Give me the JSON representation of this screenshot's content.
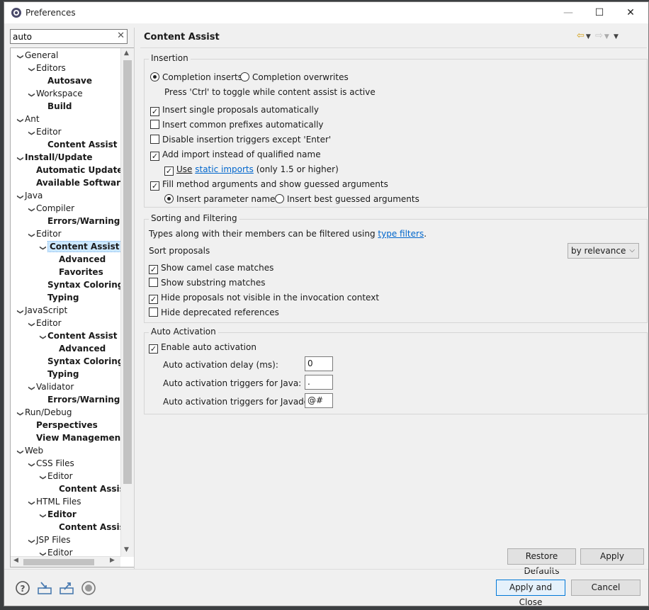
{
  "window": {
    "title": "Preferences",
    "min_label": "—",
    "max_label": "☐",
    "close_label": "✕"
  },
  "filter": {
    "value": "auto",
    "clear_label": "✕"
  },
  "tree": [
    {
      "label": "General",
      "level": 0,
      "twisty": "v",
      "bold": false
    },
    {
      "label": "Editors",
      "level": 1,
      "twisty": "v",
      "bold": false
    },
    {
      "label": "Autosave",
      "level": 2,
      "twisty": "",
      "bold": true
    },
    {
      "label": "Workspace",
      "level": 1,
      "twisty": "v",
      "bold": false
    },
    {
      "label": "Build",
      "level": 2,
      "twisty": "",
      "bold": true
    },
    {
      "label": "Ant",
      "level": 0,
      "twisty": "v",
      "bold": false
    },
    {
      "label": "Editor",
      "level": 1,
      "twisty": "v",
      "bold": false
    },
    {
      "label": "Content Assist",
      "level": 2,
      "twisty": "",
      "bold": true
    },
    {
      "label": "Install/Update",
      "level": 0,
      "twisty": "v",
      "bold": true
    },
    {
      "label": "Automatic Updates",
      "level": 1,
      "twisty": "",
      "bold": true
    },
    {
      "label": "Available Software",
      "level": 1,
      "twisty": "",
      "bold": true
    },
    {
      "label": "Java",
      "level": 0,
      "twisty": "v",
      "bold": false
    },
    {
      "label": "Compiler",
      "level": 1,
      "twisty": "v",
      "bold": false
    },
    {
      "label": "Errors/Warnings",
      "level": 2,
      "twisty": "",
      "bold": true
    },
    {
      "label": "Editor",
      "level": 1,
      "twisty": "v",
      "bold": false
    },
    {
      "label": "Content Assist",
      "level": 2,
      "twisty": "v",
      "bold": true,
      "selected": true
    },
    {
      "label": "Advanced",
      "level": 3,
      "twisty": "",
      "bold": true
    },
    {
      "label": "Favorites",
      "level": 3,
      "twisty": "",
      "bold": true
    },
    {
      "label": "Syntax Coloring",
      "level": 2,
      "twisty": "",
      "bold": true
    },
    {
      "label": "Typing",
      "level": 2,
      "twisty": "",
      "bold": true
    },
    {
      "label": "JavaScript",
      "level": 0,
      "twisty": "v",
      "bold": false
    },
    {
      "label": "Editor",
      "level": 1,
      "twisty": "v",
      "bold": false
    },
    {
      "label": "Content Assist",
      "level": 2,
      "twisty": "v",
      "bold": true
    },
    {
      "label": "Advanced",
      "level": 3,
      "twisty": "",
      "bold": true
    },
    {
      "label": "Syntax Coloring",
      "level": 2,
      "twisty": "",
      "bold": true
    },
    {
      "label": "Typing",
      "level": 2,
      "twisty": "",
      "bold": true
    },
    {
      "label": "Validator",
      "level": 1,
      "twisty": "v",
      "bold": false
    },
    {
      "label": "Errors/Warnings",
      "level": 2,
      "twisty": "",
      "bold": true
    },
    {
      "label": "Run/Debug",
      "level": 0,
      "twisty": "v",
      "bold": false
    },
    {
      "label": "Perspectives",
      "level": 1,
      "twisty": "",
      "bold": true
    },
    {
      "label": "View Management",
      "level": 1,
      "twisty": "",
      "bold": true
    },
    {
      "label": "Web",
      "level": 0,
      "twisty": "v",
      "bold": false
    },
    {
      "label": "CSS Files",
      "level": 1,
      "twisty": "v",
      "bold": false
    },
    {
      "label": "Editor",
      "level": 2,
      "twisty": "v",
      "bold": false
    },
    {
      "label": "Content Assis",
      "level": 3,
      "twisty": "",
      "bold": true
    },
    {
      "label": "HTML Files",
      "level": 1,
      "twisty": "v",
      "bold": false
    },
    {
      "label": "Editor",
      "level": 2,
      "twisty": "v",
      "bold": true
    },
    {
      "label": "Content Assis",
      "level": 3,
      "twisty": "",
      "bold": true
    },
    {
      "label": "JSP Files",
      "level": 1,
      "twisty": "v",
      "bold": false
    },
    {
      "label": "Editor",
      "level": 2,
      "twisty": "v",
      "bold": false
    }
  ],
  "page": {
    "title": "Content Assist"
  },
  "insertion": {
    "legend": "Insertion",
    "completion_inserts": "Completion inserts",
    "completion_overwrites": "Completion overwrites",
    "toggle_hint": "Press 'Ctrl' to toggle while content assist is active",
    "single_proposals": "Insert single proposals automatically",
    "common_prefixes": "Insert common prefixes automatically",
    "disable_triggers": "Disable insertion triggers except 'Enter'",
    "add_import": "Add import instead of qualified name",
    "use_label": "Use",
    "static_imports_link": "static imports",
    "only_15": "(only 1.5 or higher)",
    "fill_method": "Fill method arguments and show guessed arguments",
    "param_names": "Insert parameter names",
    "best_guessed": "Insert best guessed arguments"
  },
  "sorting": {
    "legend": "Sorting and Filtering",
    "types_text": "Types along with their members can be filtered using",
    "type_filters_link": "type filters",
    "period": ".",
    "sort_label": "Sort proposals",
    "sort_value": "by relevance",
    "camel_case": "Show camel case matches",
    "substring": "Show substring matches",
    "hide_not_visible": "Hide proposals not visible in the invocation context",
    "hide_deprecated": "Hide deprecated references"
  },
  "auto": {
    "legend": "Auto Activation",
    "enable": "Enable auto activation",
    "delay_label": "Auto activation delay (ms):",
    "delay_value": "0",
    "java_label": "Auto activation triggers for Java:",
    "java_value": ".",
    "javadoc_label": "Auto activation triggers for Javadoc:",
    "javadoc_value": "@#"
  },
  "buttons": {
    "restore": "Restore Defaults",
    "apply": "Apply",
    "apply_close": "Apply and Close",
    "cancel": "Cancel"
  },
  "colors": {
    "link": "#0066cc",
    "accent": "#0078d7",
    "selection": "#cce8ff"
  }
}
